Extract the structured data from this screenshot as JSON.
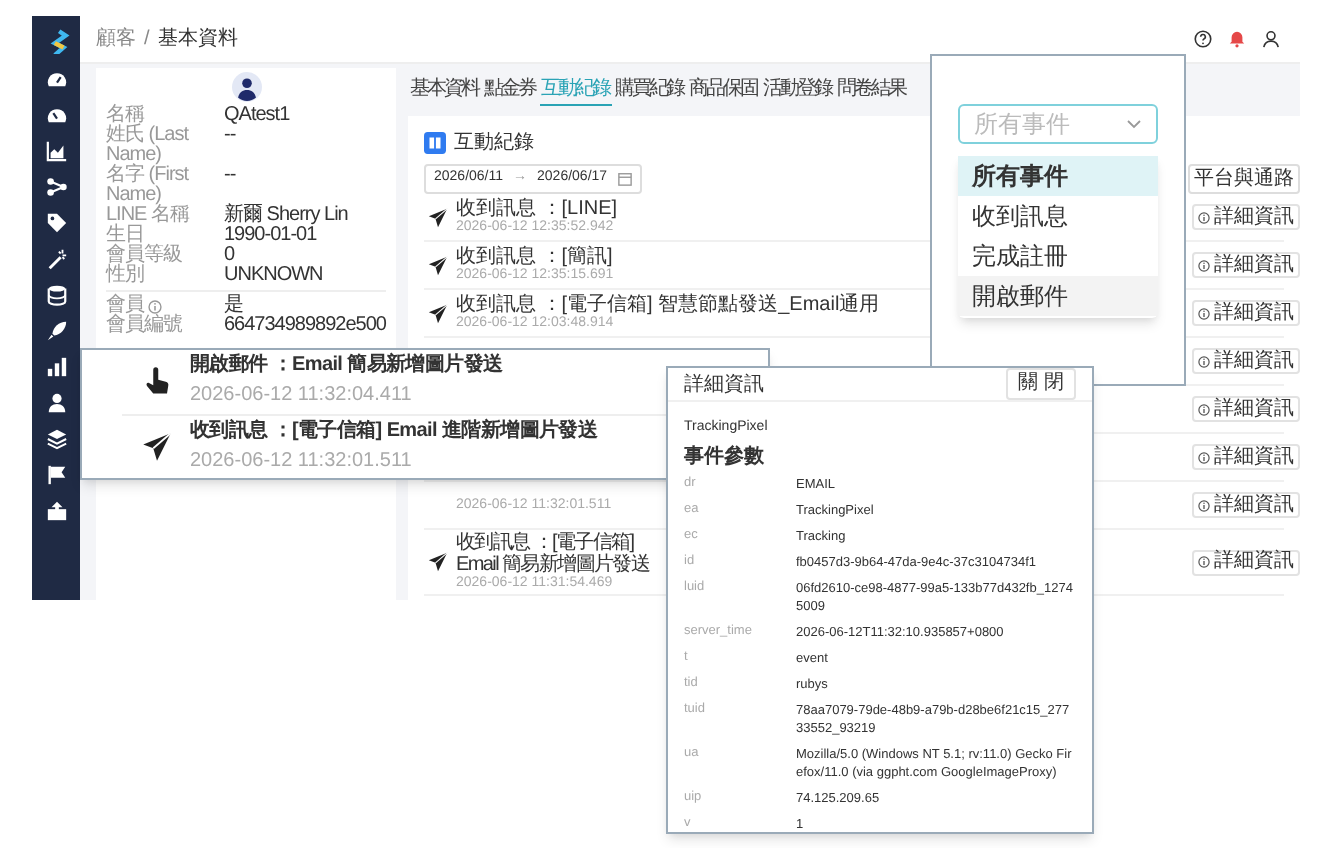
{
  "breadcrumb": [
    "顧客",
    "/",
    "基本資料"
  ],
  "profile": {
    "fields": [
      {
        "label": "名稱",
        "value": "QAtest1",
        "info": false
      },
      {
        "label": "姓氏 (Last Name)",
        "value": "--",
        "info": false
      },
      {
        "label": "名字 (First Name)",
        "value": "--",
        "info": false
      },
      {
        "label": "LINE 名稱",
        "value": "新爾 Sherry Lin",
        "info": false
      },
      {
        "label": "生日",
        "value": "1990-01-01",
        "info": false
      },
      {
        "label": "會員等級",
        "value": "0",
        "info": false
      },
      {
        "label": "性別",
        "value": "UNKNOWN",
        "info": false
      }
    ],
    "member_fields": [
      {
        "label": "會員",
        "value": "是",
        "info": true
      },
      {
        "label": "會員編號",
        "value": "664734989892e500",
        "info": false
      }
    ]
  },
  "tabs": [
    {
      "label": "基本資料",
      "selected": false
    },
    {
      "label": "點金券",
      "selected": false
    },
    {
      "label": "互動紀錄",
      "selected": true
    },
    {
      "label": "購買紀錄",
      "selected": false
    },
    {
      "label": "商品保固",
      "selected": false
    },
    {
      "label": "活動登錄",
      "selected": false
    },
    {
      "label": "問卷結果",
      "selected": false
    }
  ],
  "panel": {
    "title": "互動紀錄",
    "date_from": "2026/06/11",
    "date_arrow": "→",
    "date_to": "2026/06/17",
    "platform_filter": "平台與通路"
  },
  "events": [
    {
      "kind": "message",
      "title": "收到訊息 ：[LINE]",
      "time": "2026-06-12 12:35:52.942",
      "action": "詳細資訊"
    },
    {
      "kind": "message",
      "title": "收到訊息 ：[簡訊]",
      "time": "2026-06-12 12:35:15.691",
      "action": "詳細資訊"
    },
    {
      "kind": "message",
      "title": "收到訊息 ：[電子信箱] 智慧節點發送_Email通用",
      "time": "2026-06-12 12:03:48.914",
      "action": "詳細資訊"
    },
    {
      "action": "詳細資訊"
    },
    {
      "action": "詳細資訊"
    },
    {
      "action": "詳細資訊"
    },
    {
      "time": "2026-06-12 11:32:01.511",
      "action": "詳細資訊"
    },
    {
      "kind": "message",
      "title": "收到訊息 ：[電子信箱] Email 簡易新增圖片發送",
      "time": "2026-06-12 11:31:54.469",
      "action": "詳細資訊"
    }
  ],
  "zoom_rows": [
    {
      "kind": "open",
      "title": "開啟郵件 ：Email 簡易新增圖片發送",
      "time": "2026-06-12 11:32:04.411"
    },
    {
      "kind": "message",
      "title": "收到訊息 ：[電子信箱] Email 進階新增圖片發送",
      "time": "2026-06-12 11:32:01.511"
    }
  ],
  "event_filter": {
    "placeholder": "所有事件",
    "options": [
      {
        "label": "所有事件",
        "selected": true,
        "hovered": false
      },
      {
        "label": "收到訊息",
        "selected": false,
        "hovered": false
      },
      {
        "label": "完成註冊",
        "selected": false,
        "hovered": false
      },
      {
        "label": "開啟郵件",
        "selected": false,
        "hovered": true
      }
    ]
  },
  "detail": {
    "title": "詳細資訊",
    "close": "關 閉",
    "name": "TrackingPixel",
    "section": "事件參數",
    "params": [
      {
        "key": "dr",
        "value": "EMAIL"
      },
      {
        "key": "ea",
        "value": "TrackingPixel"
      },
      {
        "key": "ec",
        "value": "Tracking"
      },
      {
        "key": "id",
        "value": "fb0457d3-9b64-47da-9e4c-37c3104734f1"
      },
      {
        "key": "luid",
        "value": "06fd2610-ce98-4877-99a5-133b77d432fb_12745009"
      },
      {
        "key": "server_time",
        "value": "2026-06-12T11:32:10.935857+0800"
      },
      {
        "key": "t",
        "value": "event"
      },
      {
        "key": "tid",
        "value": "rubys"
      },
      {
        "key": "tuid",
        "value": "78aa7079-79de-48b9-a79b-d28be6f21c15_27733552_93219"
      },
      {
        "key": "ua",
        "value": "Mozilla/5.0 (Windows NT 5.1; rv:11.0) Gecko Firefox/11.0 (via ggpht.com GoogleImageProxy)"
      },
      {
        "key": "uip",
        "value": "74.125.209.65"
      },
      {
        "key": "v",
        "value": "1"
      }
    ]
  }
}
